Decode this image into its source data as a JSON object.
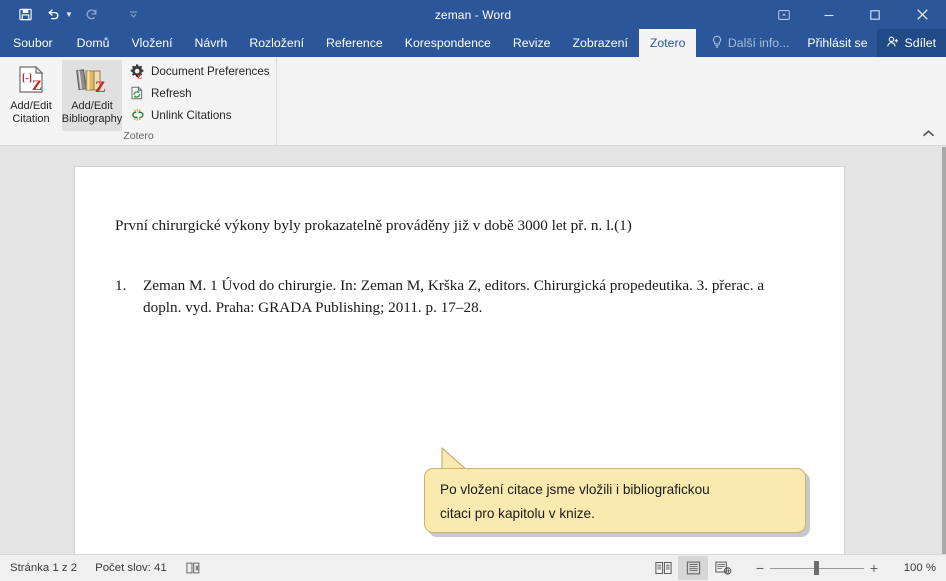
{
  "window": {
    "title": "zeman - Word",
    "quick_access": [
      {
        "name": "save-icon",
        "label": "Uložit"
      },
      {
        "name": "undo-icon",
        "label": "Zpět"
      },
      {
        "name": "redo-icon",
        "label": "Znovu"
      },
      {
        "name": "customize-qat-icon",
        "label": "Přizpůsobit panel nástrojů Rychlý přístup"
      }
    ],
    "controls": [
      {
        "name": "ribbon-display-options-icon",
        "label": "Možnosti zobrazení pásu karet"
      },
      {
        "name": "minimize-icon",
        "label": "Minimalizovat"
      },
      {
        "name": "maximize-icon",
        "label": "Maximalizovat"
      },
      {
        "name": "close-icon",
        "label": "Zavřít"
      }
    ]
  },
  "tabs": [
    {
      "label": "Soubor",
      "active": false
    },
    {
      "label": "Domů",
      "active": false
    },
    {
      "label": "Vložení",
      "active": false
    },
    {
      "label": "Návrh",
      "active": false
    },
    {
      "label": "Rozložení",
      "active": false
    },
    {
      "label": "Reference",
      "active": false
    },
    {
      "label": "Korespondence",
      "active": false
    },
    {
      "label": "Revize",
      "active": false
    },
    {
      "label": "Zobrazení",
      "active": false
    },
    {
      "label": "Zotero",
      "active": true
    }
  ],
  "tabstrip_right": {
    "tell_me": "Další info...",
    "sign_in": "Přihlásit se",
    "share": "Sdílet"
  },
  "ribbon": {
    "group_label": "Zotero",
    "big_buttons": [
      {
        "label_line1": "Add/Edit",
        "label_line2": "Citation",
        "icon": "zotero-add-edit-citation-icon",
        "selected": false
      },
      {
        "label_line1": "Add/Edit",
        "label_line2": "Bibliography",
        "icon": "zotero-add-edit-bibliography-icon",
        "selected": true
      }
    ],
    "small_buttons": [
      {
        "label": "Document Preferences",
        "icon": "zotero-document-preferences-icon"
      },
      {
        "label": "Refresh",
        "icon": "zotero-refresh-icon"
      },
      {
        "label": "Unlink Citations",
        "icon": "zotero-unlink-citations-icon"
      }
    ],
    "collapse_label": "Sbalit pás karet"
  },
  "document": {
    "paragraph": "První chirurgické výkony byly prokazatelně prováděny již v době 3000 let př. n. l.(1)",
    "bibliography": [
      {
        "number": "1.",
        "text": "Zeman M. 1 Úvod do chirurgie. In: Zeman M, Krška Z, editors. Chirurgická propedeutika. 3. přerac. a dopln. vyd. Praha: GRADA Publishing; 2011. p. 17–28."
      }
    ]
  },
  "callout": {
    "line1": "Po vložení citace jsme vložili i bibliografickou",
    "line2": "citaci pro kapitolu v knize."
  },
  "statusbar": {
    "page": "Stránka 1 z 2",
    "words": "Počet slov: 41",
    "proofing_icon": "proofing-errors-icon",
    "views": [
      {
        "name": "read-mode-icon",
        "label": "Režim čtení",
        "selected": false
      },
      {
        "name": "print-layout-icon",
        "label": "Rozložení při tisku",
        "selected": true
      },
      {
        "name": "web-layout-icon",
        "label": "Rozložení webové stránky",
        "selected": false
      }
    ],
    "zoom_out": "−",
    "zoom_in": "+",
    "zoom_level": "100 %"
  },
  "colors": {
    "word_blue": "#2b579a",
    "share_blue": "#204b87",
    "ribbon_bg": "#f4f4f4",
    "doc_bg": "#e4e4e4",
    "callout_fill": "#faeab0",
    "callout_border": "#c9b273",
    "zotero_red": "#cc2229"
  }
}
